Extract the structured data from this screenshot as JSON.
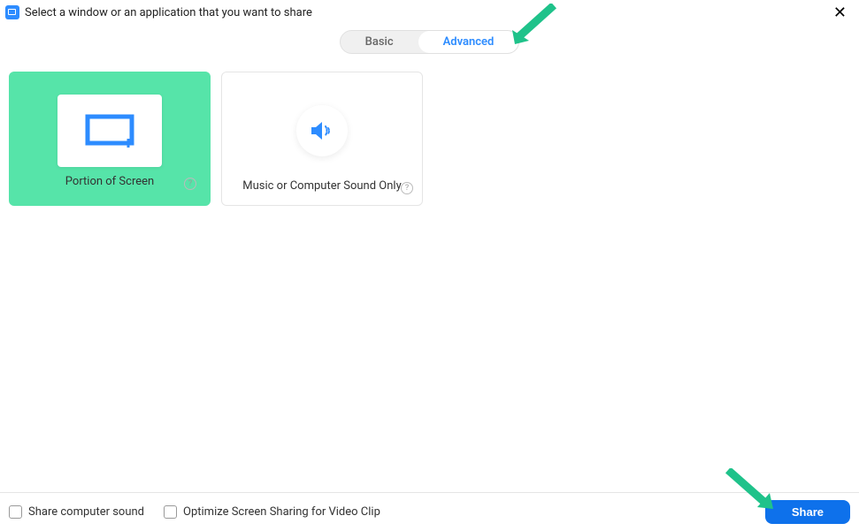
{
  "header": {
    "title": "Select a window or an application that you want to share"
  },
  "tabs": {
    "basic": "Basic",
    "advanced": "Advanced"
  },
  "options": {
    "portion": {
      "label": "Portion of Screen"
    },
    "sound": {
      "label": "Music or Computer Sound Only"
    }
  },
  "footer": {
    "share_sound": "Share computer sound",
    "optimize": "Optimize Screen Sharing for Video Clip",
    "share_button": "Share"
  },
  "colors": {
    "accent": "#2D8CFF",
    "highlight": "#56e4a9",
    "button": "#0E71EB"
  }
}
